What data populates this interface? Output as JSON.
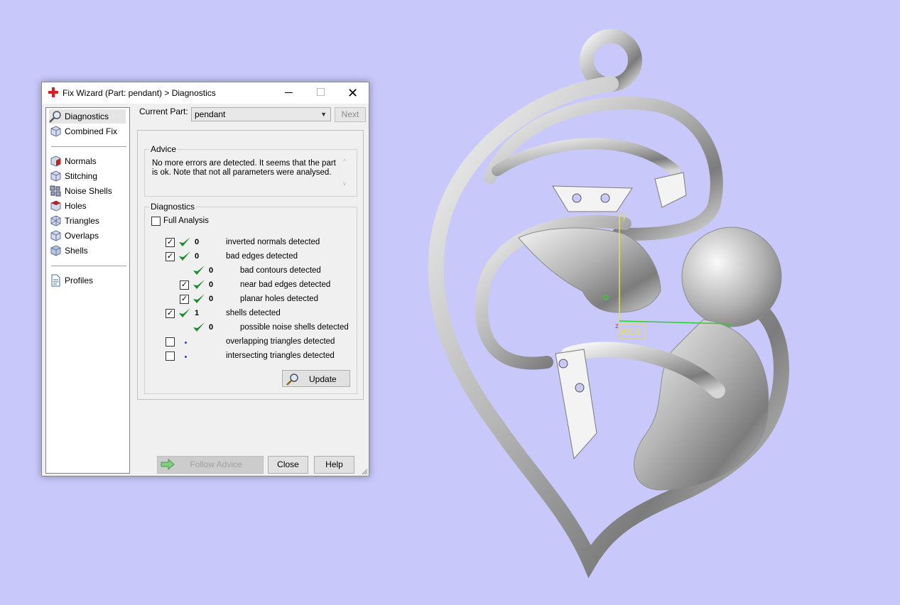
{
  "dialog": {
    "title": "Fix Wizard (Part: pendant) > Diagnostics",
    "buttons": {
      "minimize": "─",
      "maximize": "☐",
      "close": "✕"
    }
  },
  "nav": {
    "items": [
      {
        "label": "Diagnostics",
        "icon": "magnifier-icon",
        "selected": true
      },
      {
        "label": "Combined Fix",
        "icon": "cube-icon"
      },
      {
        "label": "Normals",
        "icon": "normals-cube-icon"
      },
      {
        "label": "Stitching",
        "icon": "stitching-cube-icon"
      },
      {
        "label": "Noise Shells",
        "icon": "noise-shells-icon"
      },
      {
        "label": "Holes",
        "icon": "holes-cube-icon"
      },
      {
        "label": "Triangles",
        "icon": "triangles-cube-icon"
      },
      {
        "label": "Overlaps",
        "icon": "overlaps-cube-icon"
      },
      {
        "label": "Shells",
        "icon": "shells-cube-icon"
      },
      {
        "label": "Profiles",
        "icon": "document-icon"
      }
    ]
  },
  "current_part": {
    "label": "Current Part:",
    "value": "pendant"
  },
  "next_label": "Next",
  "advice": {
    "title": "Advice",
    "text": "No more errors are detected. It seems that the part is ok. Note that not all parameters were analysed.",
    "scroll_up": "^",
    "scroll_down": "v"
  },
  "diagnostics": {
    "title": "Diagnostics",
    "full_analysis": {
      "label": "Full Analysis",
      "checked": false
    },
    "rows": [
      {
        "checkbox": true,
        "checked": true,
        "status": "ok",
        "count": "0",
        "text": "inverted normals detected"
      },
      {
        "checkbox": true,
        "checked": true,
        "status": "ok",
        "count": "0",
        "text": "bad edges detected"
      },
      {
        "checkbox": false,
        "status": "ok",
        "count": "0",
        "text": "bad contours detected"
      },
      {
        "checkbox": true,
        "checked": true,
        "status": "ok",
        "count": "0",
        "text": "near bad edges detected"
      },
      {
        "checkbox": true,
        "checked": true,
        "status": "ok",
        "count": "0",
        "text": "planar holes detected"
      },
      {
        "checkbox": true,
        "checked": true,
        "status": "ok",
        "count": "1",
        "text": "shells detected"
      },
      {
        "checkbox": false,
        "status": "ok",
        "count": "0",
        "text": "possible noise shells detected"
      },
      {
        "checkbox": true,
        "checked": false,
        "status": "pending",
        "text": "overlapping triangles detected"
      },
      {
        "checkbox": true,
        "checked": false,
        "status": "pending",
        "text": "intersecting triangles detected"
      }
    ],
    "update_label": "Update"
  },
  "footer": {
    "follow_advice": "Follow Advice",
    "close": "Close",
    "help": "Help"
  },
  "viewport": {
    "background": "#c8c8fa",
    "axis_y": "y",
    "axis_x": "x",
    "axis_z": "z",
    "wcs": "WCS",
    "axis_colors": {
      "x": "#2bd02b",
      "y": "#e6e04a",
      "z": "#e03030"
    }
  }
}
